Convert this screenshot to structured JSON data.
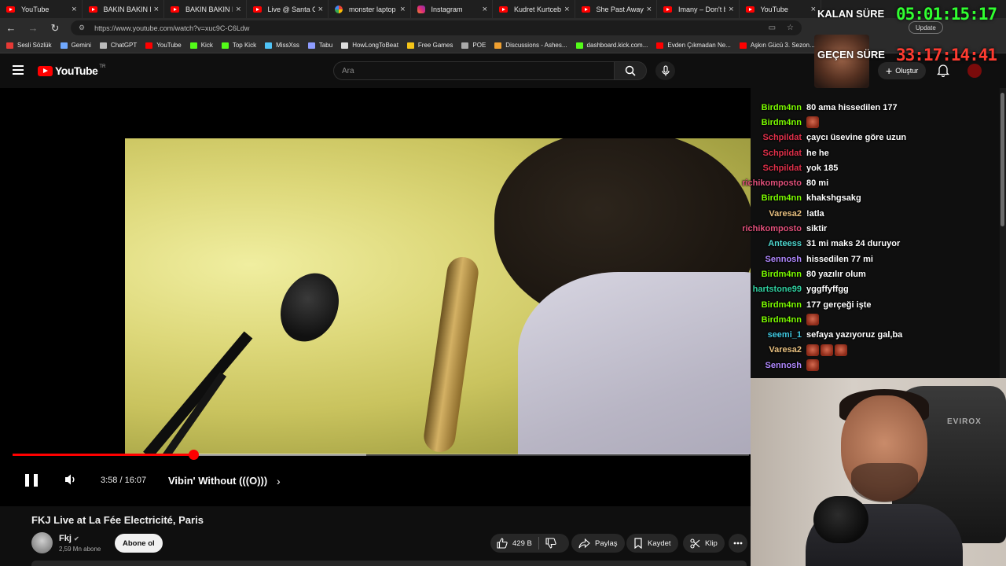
{
  "browser": {
    "tabs": [
      {
        "title": "YouTube",
        "favicon": "youtube-icon"
      },
      {
        "title": "BAKIN BAKIN NE",
        "favicon": "youtube-icon"
      },
      {
        "title": "BAKIN BAKIN NE",
        "favicon": "youtube-icon"
      },
      {
        "title": "Live @ Santa Clau",
        "favicon": "youtube-icon"
      },
      {
        "title": "monster laptop c",
        "favicon": "google-icon"
      },
      {
        "title": "Instagram",
        "favicon": "instagram-icon"
      },
      {
        "title": "Kudret Kurtcebe",
        "favicon": "youtube-icon"
      },
      {
        "title": "She Past Away - /",
        "favicon": "youtube-icon"
      },
      {
        "title": "Imany – Don't be",
        "favicon": "youtube-icon"
      },
      {
        "title": "YouTube",
        "favicon": "youtube-icon"
      }
    ],
    "url": "https://www.youtube.com/watch?v=xuc9C-C6Ldw",
    "update_label": "Update",
    "bookmarks": [
      {
        "label": "Sesli Sözlük",
        "color": "#e53935"
      },
      {
        "label": "Gemini",
        "color": "#6fa8ff"
      },
      {
        "label": "ChatGPT",
        "color": "#bbbbbb"
      },
      {
        "label": "YouTube",
        "color": "#ff0000"
      },
      {
        "label": "Kick",
        "color": "#53fc18"
      },
      {
        "label": "Top Kick",
        "color": "#53fc18"
      },
      {
        "label": "MissXss",
        "color": "#4fc3f7"
      },
      {
        "label": "Tabu",
        "color": "#8e9cff"
      },
      {
        "label": "HowLongToBeat",
        "color": "#dddddd"
      },
      {
        "label": "Free Games",
        "color": "#f5c518"
      },
      {
        "label": "POE",
        "color": "#aaaaaa"
      },
      {
        "label": "Discussions - Ashes...",
        "color": "#f0a030"
      },
      {
        "label": "dashboard.kick.com...",
        "color": "#53fc18"
      },
      {
        "label": "Evden Çıkmadan Ne...",
        "color": "#ff0000"
      },
      {
        "label": "Aşkın Gücü 3. Sezon...",
        "color": "#ff0000"
      }
    ]
  },
  "youtube": {
    "logo_text": "YouTube",
    "logo_region": "TR",
    "search_placeholder": "Ara",
    "create_label": "Oluştur"
  },
  "player": {
    "progress": 0.245,
    "buffered": 0.48,
    "time_display": "3:58 / 16:07",
    "chapter": "Vibin' Without (((O)))"
  },
  "video": {
    "title": "FKJ Live at La Fée Electricité, Paris",
    "channel": "Fkj",
    "subscribers": "2,59 Mn abone",
    "subscribe_label": "Abone ol",
    "likes": "429 B",
    "share_label": "Paylaş",
    "save_label": "Kaydet",
    "clip_label": "Klip"
  },
  "stream_overlay": {
    "remaining_label": "KALAN SÜRE",
    "remaining_value": "05:01:15:17",
    "elapsed_label": "GEÇEN SÜRE",
    "elapsed_value": "33:17:14:41",
    "remaining_color": "#30ff30",
    "elapsed_color": "#ff3b30"
  },
  "chat": [
    {
      "user": "Birdm4nn",
      "color": "#7cfc00",
      "message": "80 ama hissedilen 177",
      "emotes": 0
    },
    {
      "user": "Birdm4nn",
      "color": "#7cfc00",
      "message": "",
      "emotes": 1
    },
    {
      "user": "Schpildat",
      "color": "#e0304a",
      "message": "çaycı üsevine göre uzun",
      "emotes": 0
    },
    {
      "user": "Schpildat",
      "color": "#e0304a",
      "message": "he he",
      "emotes": 0
    },
    {
      "user": "Schpildat",
      "color": "#e0304a",
      "message": "yok 185",
      "emotes": 0
    },
    {
      "user": "richikomposto",
      "color": "#e0507a",
      "message": "80 mi",
      "emotes": 0
    },
    {
      "user": "Birdm4nn",
      "color": "#7cfc00",
      "message": "khakshgsakg",
      "emotes": 0
    },
    {
      "user": "Varesa2",
      "color": "#e8c080",
      "message": "!atla",
      "emotes": 0
    },
    {
      "user": "richikomposto",
      "color": "#e0507a",
      "message": "siktir",
      "emotes": 0
    },
    {
      "user": "Anteess",
      "color": "#4fd8d0",
      "message": "31 mi maks 24 duruyor",
      "emotes": 0
    },
    {
      "user": "Sennosh",
      "color": "#b088ff",
      "message": "hissedilen 77 mi",
      "emotes": 0
    },
    {
      "user": "Birdm4nn",
      "color": "#7cfc00",
      "message": "80 yazılır olum",
      "emotes": 0
    },
    {
      "user": "hartstone99",
      "color": "#30d0a0",
      "message": "yggffyffgg",
      "emotes": 0
    },
    {
      "user": "Birdm4nn",
      "color": "#7cfc00",
      "message": "177 gerçeği işte",
      "emotes": 0
    },
    {
      "user": "Birdm4nn",
      "color": "#7cfc00",
      "message": "",
      "emotes": 1
    },
    {
      "user": "seemi_1",
      "color": "#40c8e0",
      "message": "sefaya yazıyoruz gal,ba",
      "emotes": 0
    },
    {
      "user": "Varesa2",
      "color": "#e8c080",
      "message": "",
      "emotes": 3
    },
    {
      "user": "Sennosh",
      "color": "#b088ff",
      "message": "",
      "emotes": 1
    }
  ],
  "webcam": {
    "chair_brand": "EVIROX"
  }
}
